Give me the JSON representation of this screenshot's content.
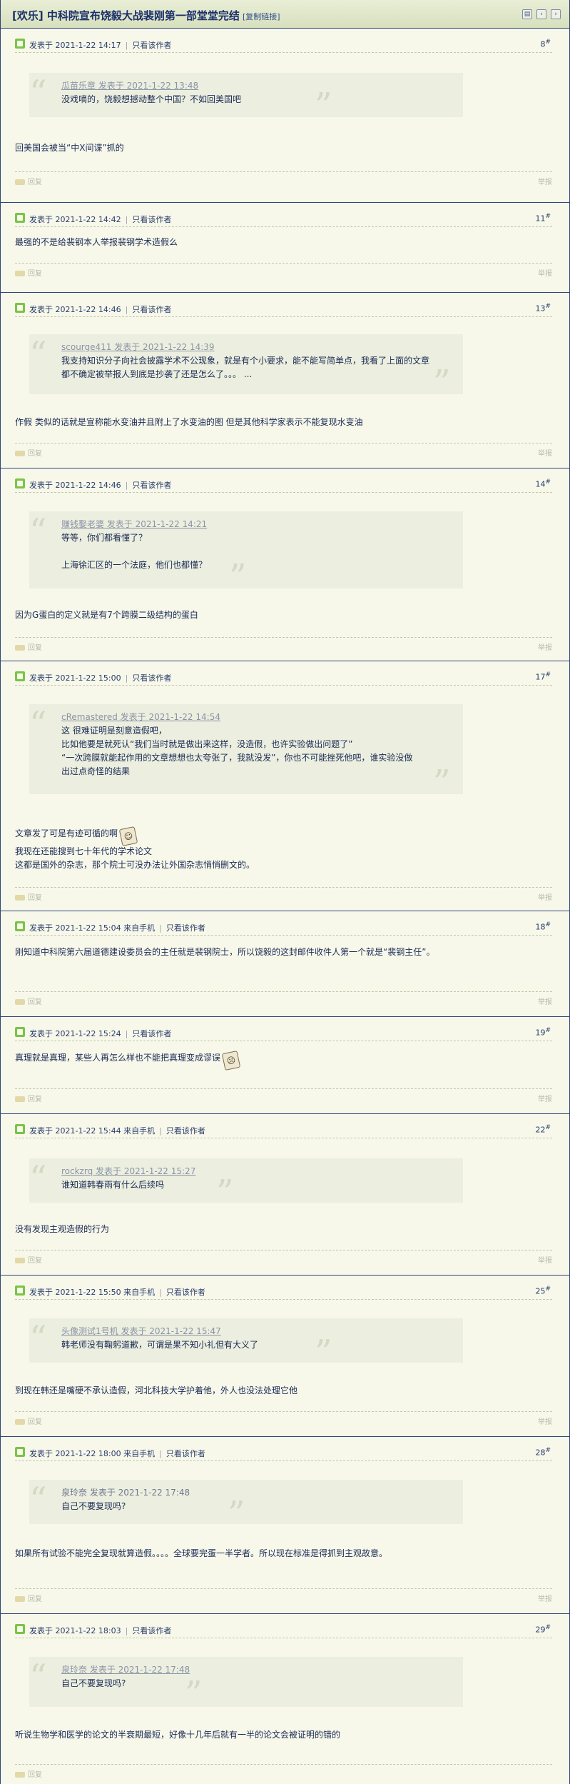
{
  "thread": {
    "title": "[欢乐] 中科院宣布饶毅大战裴刚第一部堂堂完结",
    "copy_link": "[复制链接]",
    "icons": [
      "print-icon",
      "prev-thread-icon",
      "next-thread-icon"
    ]
  },
  "labels": {
    "only_author": "只看该作者",
    "reply": "回复",
    "report": "举报"
  },
  "posts": [
    {
      "meta": "发表于 2021-1-22 14:17",
      "floor": "8",
      "quote_who": "瓜苗乐章 发表于 2021-1-22 13:48",
      "quote_text": "没戏嘀的，饶毅想撼动整个中国？不如回美国吧",
      "body": "回美国会被当“中X间谍”抓的"
    },
    {
      "meta": "发表于 2021-1-22 14:42",
      "floor": "11",
      "body": "最强的不是给裴钢本人举报裴钢学术造假么"
    },
    {
      "meta": "发表于 2021-1-22 14:46",
      "floor": "13",
      "quote_who": "scourge411 发表于 2021-1-22 14:39",
      "quote_text": "我支持知识分子向社会披露学术不公现象，就是有个小要求，能不能写简单点，我看了上面的文章都不确定被举报人到底是抄袭了还是怎么了。。。 ...",
      "body": "作假 类似的话就是宣称能水变油并且附上了水变油的图 但是其他科学家表示不能复现水变油"
    },
    {
      "meta": "发表于 2021-1-22 14:46",
      "floor": "14",
      "quote_who": "赚钱娶老婆 发表于 2021-1-22 14:21",
      "quote_text": "等等，你们都看懂了？\n\n上海徐汇区的一个法庭，他们也都懂？",
      "body": "因为G蛋白的定义就是有7个跨膜二级结构的蛋白"
    },
    {
      "meta": "发表于 2021-1-22 15:00",
      "floor": "17",
      "quote_who": "cRemastered 发表于 2021-1-22 14:54",
      "quote_text": "这 很难证明是刻意造假吧，\n比如他要是就死认“我们当时就是做出来这样，没造假，也许实验做出问题了”\n“一次跨膜就能起作用的文章想想也太夸张了，我就没发”，你也不可能挫死他吧，谁实验没做出过点奇怪的结果",
      "body_lines": [
        "文章发了可是有迹可循的啊",
        "我现在还能搜到七十年代的学术论文",
        "这都是国外的杂志，那个院士可没办法让外国杂志悄悄删文的。"
      ],
      "smiley": "smiley-icon"
    },
    {
      "meta": "发表于 2021-1-22 15:04 来自手机",
      "floor": "18",
      "body": "刚知道中科院第六届道德建设委员会的主任就是裴钢院士，所以饶毅的这封邮件收件人第一个就是“裴钢主任”。"
    },
    {
      "meta": "发表于 2021-1-22 15:24",
      "floor": "19",
      "body": "真理就是真理，某些人再怎么样也不能把真理变成谬误",
      "smiley": "smiley-icon"
    },
    {
      "meta": "发表于 2021-1-22 15:44 来自手机",
      "floor": "22",
      "quote_who": "rockzrq 发表于 2021-1-22 15:27",
      "quote_text": "谁知道韩春雨有什么后续吗",
      "body": "没有发现主观造假的行为"
    },
    {
      "meta": "发表于 2021-1-22 15:50 来自手机",
      "floor": "25",
      "quote_who": "头像测试1号机 发表于 2021-1-22 15:47",
      "quote_text": "韩老师没有鞠躬道歉，可谓是果不知小礼但有大义了",
      "body": "到现在韩还是嘴硬不承认造假，河北科技大学护着他，外人也没法处理它他"
    },
    {
      "meta": "发表于 2021-1-22 18:00 来自手机",
      "floor": "28",
      "quote_who": "泉玲奈 发表于 2021-1-22 17:48",
      "quote_text": "自己不要复现吗?",
      "body": "如果所有试验不能完全复现就算造假。。。。全球要完蛋一半学者。所以现在标准是得抓到主观故意。"
    },
    {
      "meta": "发表于 2021-1-22 18:03",
      "floor": "29",
      "quote_who": "泉玲奈 发表于 2021-1-22 17:48",
      "quote_text": "自己不要复现吗?",
      "body": "听说生物学和医学的论文的半衰期最短，好像十几年后就有一半的论文会被证明的错的"
    }
  ]
}
